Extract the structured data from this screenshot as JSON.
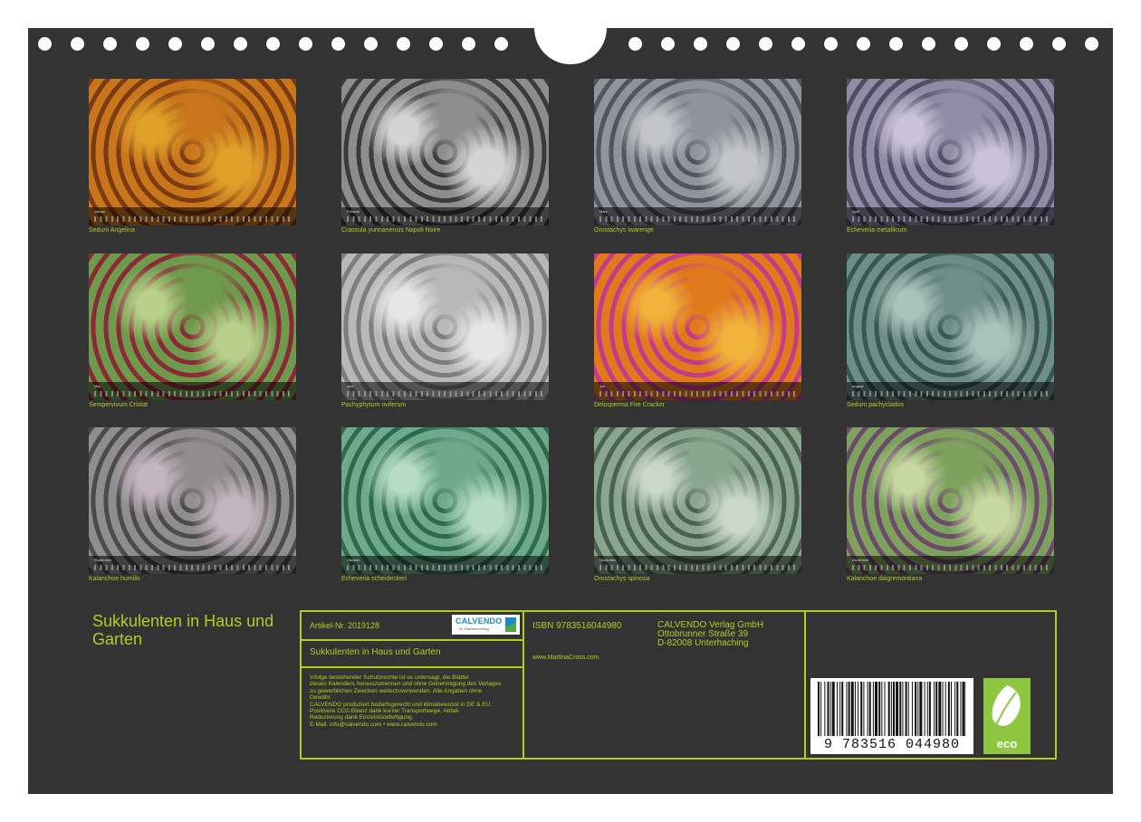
{
  "calendar": {
    "title": "Sukkulenten in Haus und Garten",
    "months": [
      {
        "month": "Januar",
        "plant": "Sedum Angelina",
        "palette": [
          "#c9751c",
          "#e0a12a",
          "#7a3a12"
        ]
      },
      {
        "month": "Februar",
        "plant": "Crassula yunnanensis Napoli Noire",
        "palette": [
          "#8d8d8d",
          "#d4d4d4",
          "#3b3b3b"
        ]
      },
      {
        "month": "März",
        "plant": "Orostachys iwarenge",
        "palette": [
          "#8e949a",
          "#c2c6ca",
          "#51565c"
        ]
      },
      {
        "month": "April",
        "plant": "Echeveria metallicum",
        "palette": [
          "#8f8ca6",
          "#c9c3d9",
          "#4e4b62"
        ]
      },
      {
        "month": "Mai",
        "plant": "Sempervivum Cristat",
        "palette": [
          "#6f9a4c",
          "#b8d08a",
          "#8a2a38"
        ]
      },
      {
        "month": "Juni",
        "plant": "Pachyphytum oviferum",
        "palette": [
          "#b8b8b8",
          "#e6e6e6",
          "#7d7d7d"
        ]
      },
      {
        "month": "Juli",
        "plant": "Delosperma Fire Cracker",
        "palette": [
          "#e07a1c",
          "#f2b33a",
          "#c63a8a"
        ]
      },
      {
        "month": "August",
        "plant": "Sedum pachyclados",
        "palette": [
          "#6e8f88",
          "#a9c2ba",
          "#3a5650"
        ]
      },
      {
        "month": "September",
        "plant": "Kalanchoe humilis",
        "palette": [
          "#8f8d8e",
          "#c4b6bd",
          "#4b4a4c"
        ]
      },
      {
        "month": "Oktober",
        "plant": "Echeveria scheideckeri",
        "palette": [
          "#6fa98d",
          "#b6dcc4",
          "#2f6a4c"
        ]
      },
      {
        "month": "November",
        "plant": "Orostachys spinosa",
        "palette": [
          "#8aa68e",
          "#c9d8c8",
          "#4c6251"
        ]
      },
      {
        "month": "Dezember",
        "plant": "Kalanchoe daigremontiana",
        "palette": [
          "#7ea25e",
          "#c7d9a3",
          "#6b4a6a"
        ]
      }
    ]
  },
  "info": {
    "artikel": "Artikel-Nr. 2019128",
    "logo_name": "CALVENDO",
    "logo_sub": "Ihr Kalenderverlag",
    "product_title": "Sukkulenten in Haus und Garten",
    "legal_lines": [
      "Infolge bestehender Schutzrechte ist es untersagt, die Blätter",
      "dieses Kalenders herauszutrennen und ohne Genehmigung des Verlages",
      "zu gewerblichen Zwecken weiterzuverwenden. Alle Angaben ohne",
      "Gewähr.",
      "CALVENDO produziert bedarfsgerecht und klimabewusst in DE & EU.",
      "Positivere CO2-Bilanz dank kurzer Transportwege. Abfall-",
      "Reduzierung dank Einzelstückfertigung.",
      "E-Mail: info@calvendo.com • www.calvendo.com"
    ],
    "isbn": "ISBN 9783516044980",
    "website": "www.MartinaCross.com",
    "publisher": [
      "CALVENDO Verlag GmbH",
      "Ottobrunner Straße 39",
      "D-82008 Unterhaching"
    ],
    "barcode_number": "9 783516 044980",
    "eco_label": "eco"
  },
  "colors": {
    "background": "#333333",
    "accent": "#b5cc1f",
    "paper": "#ffffff"
  }
}
